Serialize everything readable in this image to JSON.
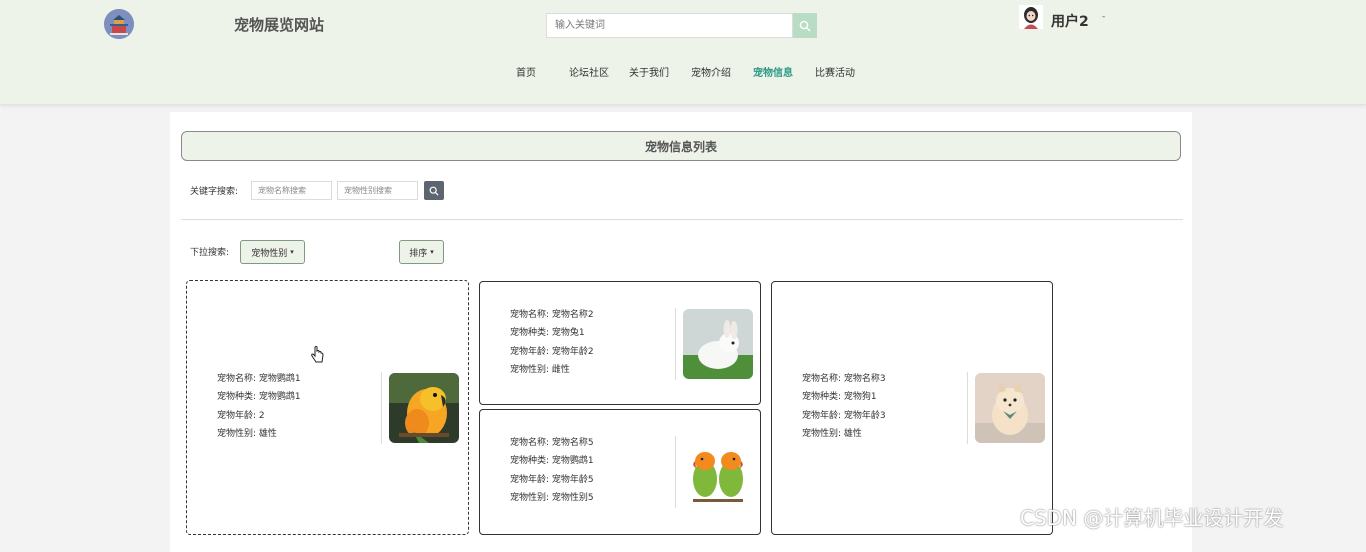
{
  "header": {
    "site_title": "宠物展览网站",
    "search_placeholder": "输入关键词",
    "username": "用户2",
    "user_caret": "-"
  },
  "nav": [
    {
      "label": "首页"
    },
    {
      "label": "论坛社区"
    },
    {
      "label": "关于我们"
    },
    {
      "label": "宠物介绍"
    },
    {
      "label": "宠物信息",
      "active": true
    },
    {
      "label": "比赛活动"
    }
  ],
  "main": {
    "list_title": "宠物信息列表",
    "keyword_label": "关键字搜索:",
    "name_placeholder": "宠物名称搜索",
    "gender_placeholder": "宠物性别搜索",
    "dropdown_label": "下拉搜索:",
    "gender_dropdown": "宠物性别",
    "sort_dropdown": "排序",
    "caret": "▾"
  },
  "cards": [
    {
      "name": "宠物名称: 宠物鹦鹉1",
      "species": "宠物种类: 宠物鹦鹉1",
      "age": "宠物年龄: 2",
      "gender": "宠物性别: 雄性",
      "image": "orange-parrot"
    },
    {
      "name": "宠物名称: 宠物名称2",
      "species": "宠物种类: 宠物兔1",
      "age": "宠物年龄: 宠物年龄2",
      "gender": "宠物性别: 雌性",
      "image": "white-rabbit"
    },
    {
      "name": "宠物名称: 宠物名称3",
      "species": "宠物种类: 宠物狗1",
      "age": "宠物年龄: 宠物年龄3",
      "gender": "宠物性别: 雄性",
      "image": "pomeranian-dog"
    },
    {
      "name": "宠物名称: 宠物名称5",
      "species": "宠物种类: 宠物鹦鹉1",
      "age": "宠物年龄: 宠物年龄5",
      "gender": "宠物性别: 宠物性别5",
      "image": "lovebird-pair"
    }
  ],
  "watermark": "CSDN @计算机毕业设计开发",
  "colors": {
    "header_bg": "#eef3ea",
    "active_nav": "#2e9a84",
    "search_btn": "#b9dcc4",
    "keyword_btn": "#5d6670"
  }
}
